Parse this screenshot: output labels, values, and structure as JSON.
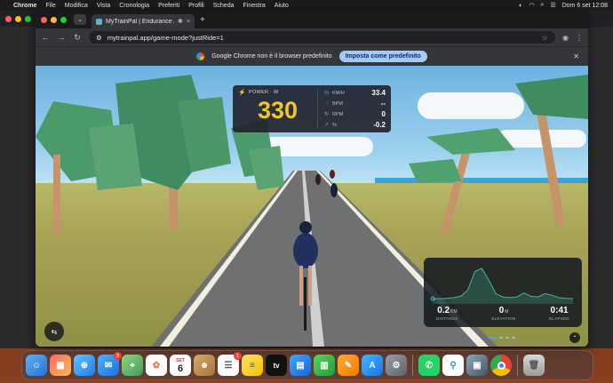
{
  "menubar": {
    "app": "Chrome",
    "items": [
      "File",
      "Modifica",
      "Vista",
      "Cronologia",
      "Preferiti",
      "Profili",
      "Scheda",
      "Finestra",
      "Aiuto"
    ],
    "clock": "Dom 6 set  12:08"
  },
  "browser": {
    "tab_title": "MyTrainPal | Endurance A",
    "url": "mytrainpal.app/game-mode?justRide=1",
    "infobar_text": "Google Chrome non è il browser predefinito",
    "infobar_button": "Imposta come predefinito"
  },
  "hud": {
    "power_label": "POWER · W",
    "power_value": "330",
    "metrics": [
      {
        "icon": "speed-icon",
        "label": "KM/H",
        "value": "33.4",
        "color": "#58b7e8"
      },
      {
        "icon": "heart-icon",
        "label": "BPM",
        "value": "--",
        "color": "#e8607a"
      },
      {
        "icon": "cadence-icon",
        "label": "RPM",
        "value": "0",
        "color": "#5fd08a"
      },
      {
        "icon": "grade-icon",
        "label": "%",
        "value": "-0.2",
        "color": "#a08ce8"
      }
    ]
  },
  "elevation_panel": {
    "stats": [
      {
        "value": "0.2",
        "unit": "KM",
        "label": "DISTANCE"
      },
      {
        "value": "0",
        "unit": "M",
        "label": "ELEVATION"
      },
      {
        "value": "0:41",
        "unit": "",
        "label": "ELAPSED"
      }
    ],
    "profile": [
      0.05,
      0.05,
      0.06,
      0.08,
      0.12,
      0.3,
      0.85,
      0.95,
      0.6,
      0.2,
      0.1,
      0.08,
      0.1,
      0.22,
      0.12,
      0.1,
      0.2,
      0.15,
      0.08,
      0.06,
      0.05
    ],
    "accent": "#3fb8a0"
  },
  "dock": {
    "calendar_month": "SET",
    "calendar_day": "6",
    "mail_badge": "3",
    "reminders_badge": "1",
    "tv_label": "tv"
  }
}
